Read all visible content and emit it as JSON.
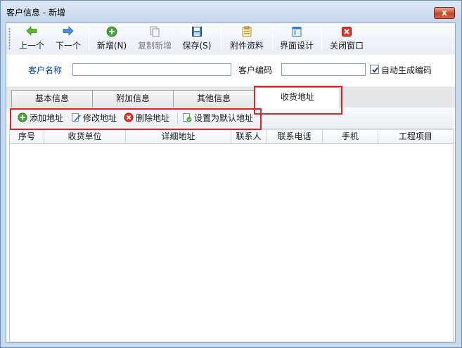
{
  "window": {
    "title": "客户信息 - 新增",
    "close_label": "x"
  },
  "toolbar": {
    "prev": "上一个",
    "next": "下一个",
    "add": "新增(N)",
    "copy_add": "复制新增",
    "save": "保存(S)",
    "attachments": "附件资料",
    "ui_design": "界面设计",
    "close_window": "关闭窗口"
  },
  "form": {
    "customer_name_label": "客户名称",
    "customer_name_value": "",
    "customer_code_label": "客户编码",
    "customer_code_value": "",
    "auto_code_label": "自动生成编码",
    "auto_code_checked": true
  },
  "tabs": [
    {
      "label": "基本信息",
      "active": false
    },
    {
      "label": "附加信息",
      "active": false
    },
    {
      "label": "其他信息",
      "active": false
    },
    {
      "label": "收货地址",
      "active": true
    }
  ],
  "address_actions": {
    "add": "添加地址",
    "edit": "修改地址",
    "delete": "删除地址",
    "set_default": "设置为默认地址"
  },
  "table": {
    "columns": [
      "序号",
      "收货单位",
      "详细地址",
      "联系人",
      "联系电话",
      "手机",
      "工程项目"
    ],
    "rows": []
  },
  "colors": {
    "highlight": "#d9252b",
    "label_blue": "#0645ad",
    "titlebar": "#c7d9ec"
  }
}
